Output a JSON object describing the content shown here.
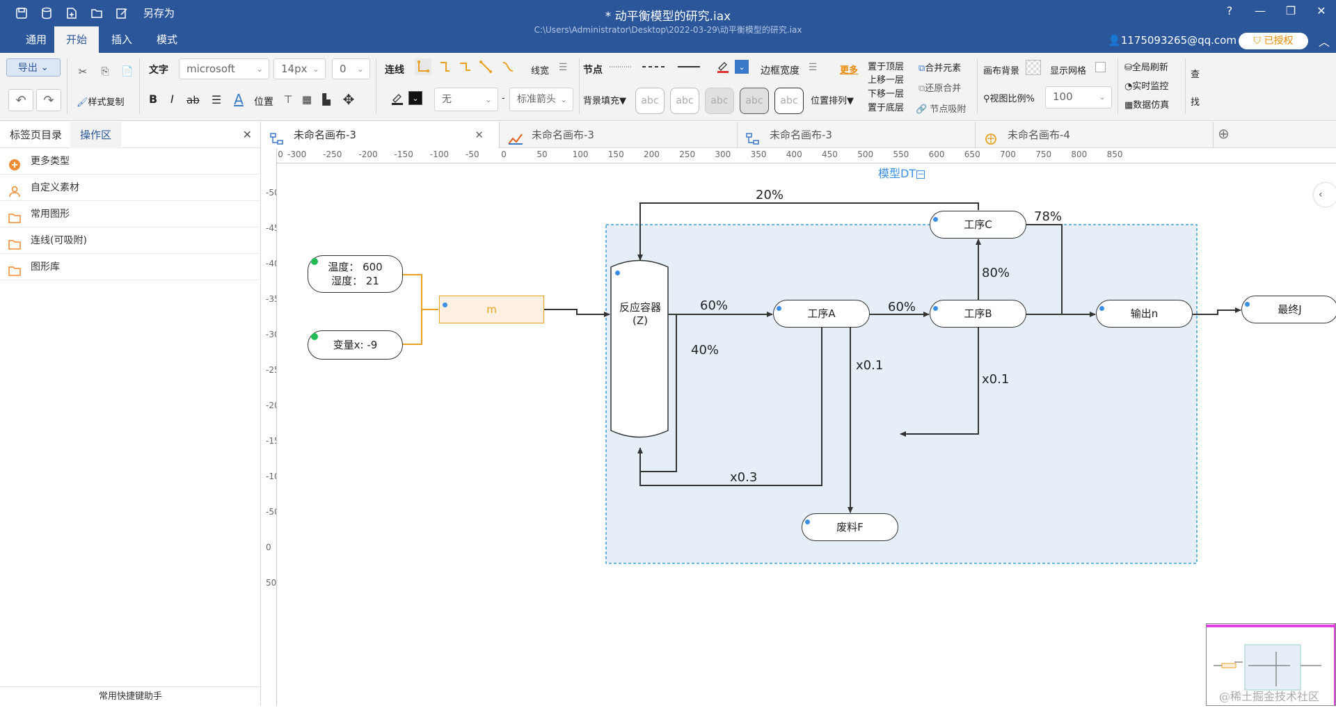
{
  "titlebar": {
    "save_as": "另存为",
    "title": "*  动平衡模型的研究.iax",
    "path": "C:\\Users\\Administrator\\Desktop\\2022-03-29\\动平衡模型的研究.iax"
  },
  "menubar": {
    "tabs": [
      "通用",
      "开始",
      "插入",
      "模式"
    ],
    "active": "开始",
    "user": "1175093265@qq.com",
    "auth": "已授权"
  },
  "ribbon": {
    "export": "导出",
    "format_copy": "样式复制",
    "text_label": "文字",
    "font": "microsoft",
    "font_size": "14px",
    "spacing": "0",
    "bold": "B",
    "italic": "I",
    "strike": "ab",
    "position": "位置",
    "connect": "连线",
    "line_width": "线宽",
    "none": "无",
    "arrow": "标准箭头",
    "dash": "-",
    "bg_fill": "背景填充▼",
    "node": "节点",
    "border_width": "边框宽度",
    "more": "更多",
    "layer_top": "置于顶层",
    "layer_up": "上移一层",
    "layer_down": "下移一层",
    "layer_bottom": "置于底层",
    "pos_arrange": "位置排列▼",
    "merge": "合并元素",
    "unmerge": "还原合并",
    "snap": "节点吸附",
    "canvas_bg": "画布背景",
    "show_grid": "显示网格",
    "view_ratio": "视图比例%",
    "view_ratio_val": "100",
    "refresh_all": "全局刷新",
    "realtime": "实时监控",
    "simulate": "数据仿真",
    "find1": "查",
    "find2": "找",
    "abc": [
      "abc",
      "abc",
      "abc",
      "abc",
      "abc"
    ]
  },
  "leftpanel": {
    "tabs": [
      "标签页目录",
      "操作区"
    ],
    "items": [
      "更多类型",
      "自定义素材",
      "常用图形",
      "连线(可吸附)",
      "图形库"
    ],
    "footer": "常用快捷键助手"
  },
  "doctabs": [
    "未命名画布-3",
    "未命名画布-3",
    "未命名画布-3",
    "未命名画布-4"
  ],
  "rulers": {
    "h": [
      "-300",
      "-250",
      "-200",
      "-150",
      "-100",
      "-50",
      "0",
      "50",
      "100",
      "150",
      "200",
      "250",
      "300",
      "350",
      "400",
      "450",
      "500",
      "550",
      "600",
      "650",
      "700",
      "750",
      "800",
      "850"
    ],
    "h_first": "550",
    "v": [
      "-500",
      "-450",
      "-400",
      "-350",
      "-300",
      "-250",
      "-200",
      "-150",
      "-100",
      "-50",
      "0",
      "50"
    ]
  },
  "diagram": {
    "group_title": "模型DT",
    "temp": "温度：  600",
    "humid": "湿度：  21",
    "var": "变量x: -9",
    "m": "m",
    "reactor": "反应容器",
    "reactor_z": "(Z)",
    "proc_a": "工序A",
    "proc_b": "工序B",
    "proc_c": "工序C",
    "output": "输出n",
    "final": "最终J",
    "waste": "废料F",
    "labels": {
      "l20": "20%",
      "l78": "78%",
      "l80": "80%",
      "l60a": "60%",
      "l60b": "60%",
      "l40": "40%",
      "lx01a": "x0.1",
      "lx01b": "x0.1",
      "lx03": "x0.3"
    }
  },
  "watermark": "@稀土掘金技术社区",
  "colors": {
    "brand": "#2b579a",
    "accent_orange": "#e8a020",
    "group_fill": "#e6eef8",
    "group_border": "#3aa0d8"
  }
}
